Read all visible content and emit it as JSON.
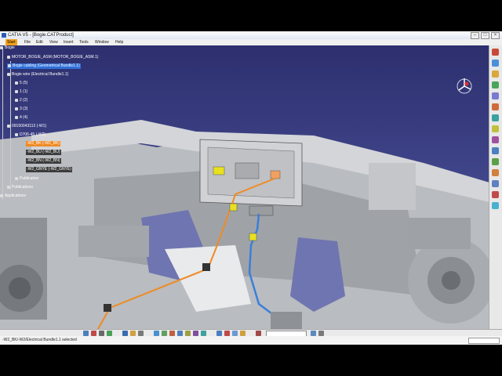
{
  "window": {
    "title": "CATIA V5 - [Bogie.CATProduct]"
  },
  "menu": [
    "Start",
    "File",
    "Edit",
    "View",
    "Insert",
    "Tools",
    "Window",
    "Help"
  ],
  "tree": {
    "root": "Bogie",
    "items": [
      "MOTOR_BOGIE_ASM (MOTOR_BOGIE_ASM.1)",
      "Bogie cabling (Geometrical Bundle1.1)",
      "Bogie wire (Electrical Bundle1.1)",
      "5 (5)",
      "1 (1)",
      "2 (2)",
      "3 (3)",
      "4 (4)",
      "09150043113 (-W1)",
      "D706-45 (-W2)",
      "-W2_BK (-W2_BK)",
      "-W2_BU (-W2_BU)",
      "-W2_BN (-W2_BN)",
      "-W2_GNYE (-W2_GNYE)",
      "Publication",
      "Publications",
      "Applications"
    ]
  },
  "status": {
    "text": "-W2_BK/-W2/Electrical Bundle1.1 selected"
  },
  "icons": {
    "compass": "compass-icon"
  },
  "colors": {
    "background_top": "#2d2f6e",
    "background_bottom": "#5a62a6",
    "selection": "#2f6fd8",
    "wire_orange": "#f08a24",
    "wire_blue": "#3a7fd8",
    "connector_yellow": "#e8e020",
    "menu_active": "#f4a21c"
  }
}
